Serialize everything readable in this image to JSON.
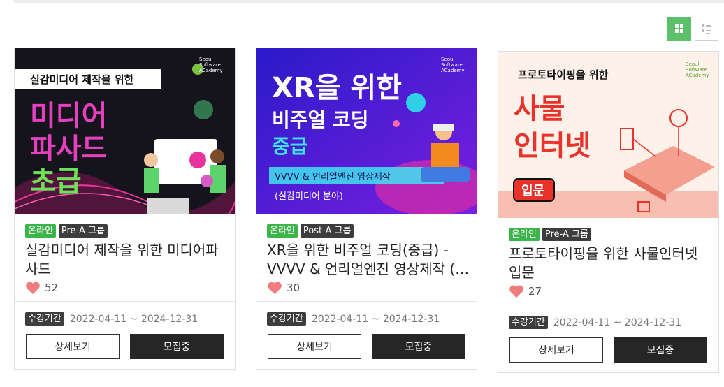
{
  "view_toggle": {
    "grid_icon": "grid-view-icon",
    "list_icon": "list-view-icon"
  },
  "cards": [
    {
      "thumb": {
        "logo_text": [
          "Seoul",
          "Software",
          "ACademy"
        ],
        "tagline": "실감미디어 제작을 위한",
        "big_lines": [
          "미디어",
          "파사드",
          "초급"
        ],
        "bg": "#14141e",
        "accent": "#e8339a"
      },
      "badges": [
        "온라인",
        "Pre-A 그룹"
      ],
      "title": "실감미디어 제작을 위한 미디어파사드",
      "likes": "52",
      "period_label": "수강기간",
      "period": "2022-04-11 ~ 2024-12-31",
      "detail_button": "상세보기",
      "recruit_button": "모집중"
    },
    {
      "thumb": {
        "logo_text": [
          "Seoul",
          "Software",
          "ACademy"
        ],
        "headline_a": "XR을 위한",
        "headline_b": "비주얼 코딩",
        "headline_c": "중급",
        "banner": "VVVV & 언리얼엔진 영상제작",
        "sub": "(실감미디어 분야)",
        "bg": "#3b1fd6"
      },
      "badges": [
        "온라인",
        "Post-A 그룹"
      ],
      "title": "XR을 위한 비주얼 코딩(중급) - VVVV & 언리얼엔진 영상제작 (…",
      "likes": "30",
      "period_label": "수강기간",
      "period": "2022-04-11 ~ 2024-12-31",
      "detail_button": "상세보기",
      "recruit_button": "모집중"
    },
    {
      "thumb": {
        "logo_text": [
          "Seoul",
          "Software",
          "ACademy"
        ],
        "tagline": "프로토타이핑을 위한",
        "big_lines": [
          "사물",
          "인터넷"
        ],
        "level": "입문",
        "bg": "#fdf1ea"
      },
      "badges": [
        "온라인",
        "Pre-A 그룹"
      ],
      "title": "프로토타이핑을 위한 사물인터넷 입문",
      "likes": "27",
      "period_label": "수강기간",
      "period": "2022-04-11 ~ 2024-12-31",
      "detail_button": "상세보기",
      "recruit_button": "모집중"
    }
  ]
}
